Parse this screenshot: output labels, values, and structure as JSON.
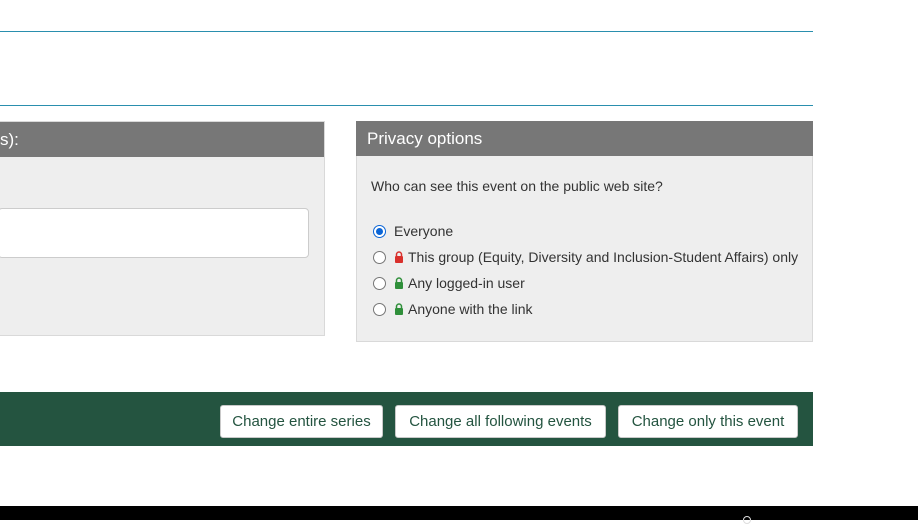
{
  "left_panel": {
    "header": "s):"
  },
  "privacy": {
    "header": "Privacy options",
    "question": "Who can see this event on the public web site?",
    "options": [
      {
        "label": "Everyone",
        "selected": true,
        "lock": null
      },
      {
        "label": "This group (Equity, Diversity and Inclusion-Student Affairs) only",
        "selected": false,
        "lock": "#d9302c"
      },
      {
        "label": "Any logged-in user",
        "selected": false,
        "lock": "#2f8f3a"
      },
      {
        "label": "Anyone with the link",
        "selected": false,
        "lock": "#2f8f3a"
      }
    ]
  },
  "actions": {
    "change_entire_series": "Change entire series",
    "change_all_following": "Change all following events",
    "change_only_this": "Change only this event"
  },
  "colors": {
    "panel_header": "#777777",
    "panel_bg": "#eeeeee",
    "action_bar": "#245440",
    "rule": "#2a8fae"
  }
}
